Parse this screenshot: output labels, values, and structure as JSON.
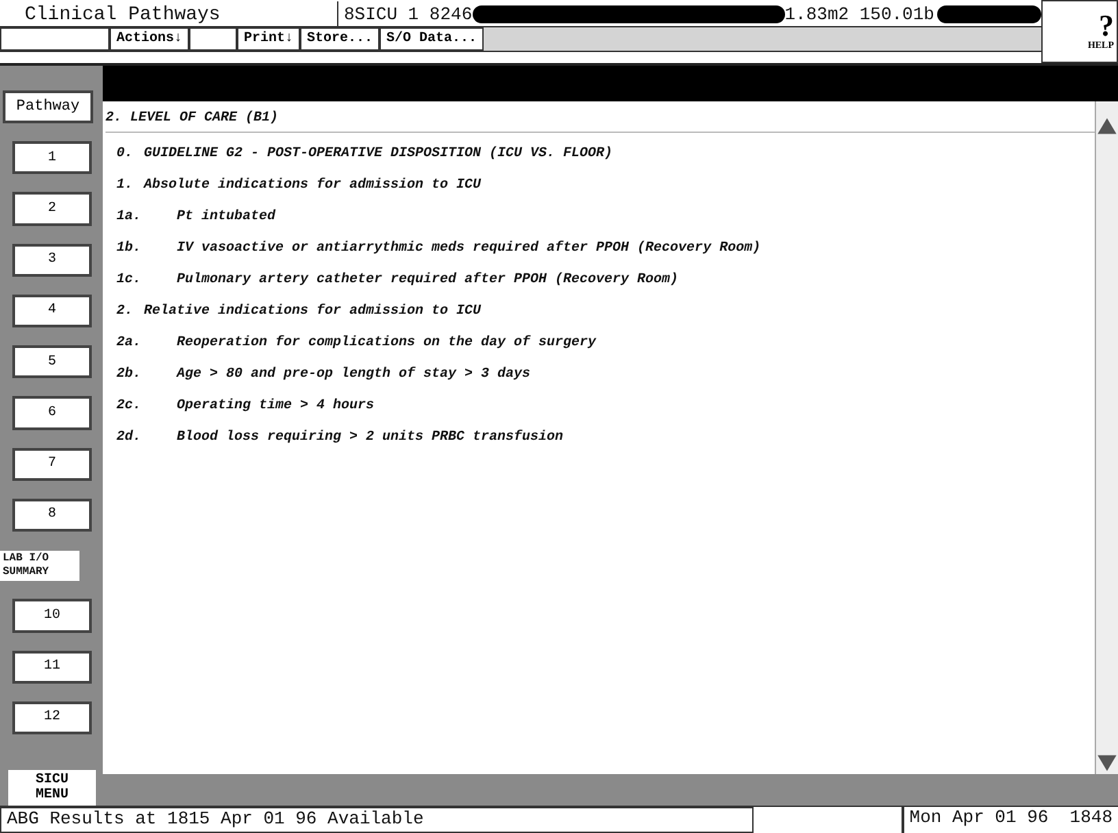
{
  "window": {
    "title": "Clinical Pathways"
  },
  "patient": {
    "unit": "8SICU 1 8246",
    "measures": "1.83m2 150.01b"
  },
  "help_button": {
    "icon": "?",
    "label": "HELP"
  },
  "toolbar": [
    {
      "kind": "blank"
    },
    {
      "label": "Actions↓"
    },
    {
      "kind": "blank"
    },
    {
      "label": "Print↓"
    },
    {
      "label": "Store..."
    },
    {
      "label": "S/O Data..."
    }
  ],
  "sidebar": {
    "header": "Pathway",
    "items": [
      {
        "label": "1"
      },
      {
        "label": "2"
      },
      {
        "label": "3"
      },
      {
        "label": "4"
      },
      {
        "label": "5"
      },
      {
        "label": "6"
      },
      {
        "label": "7"
      },
      {
        "label": "8"
      },
      {
        "overlay": "LAB I/O SUMMARY"
      },
      {
        "label": "10"
      },
      {
        "label": "11"
      },
      {
        "label": "12"
      }
    ],
    "menu": "SICU MENU"
  },
  "content": {
    "heading": "2. LEVEL OF CARE (B1)",
    "lines": [
      {
        "num": "0.",
        "text": "GUIDELINE G2 - POST-OPERATIVE DISPOSITION (ICU VS. FLOOR)",
        "kind": "head"
      },
      {
        "num": "1.",
        "text": "Absolute indications for admission to ICU",
        "kind": "head"
      },
      {
        "num": "1a.",
        "text": "Pt intubated",
        "kind": "sub"
      },
      {
        "num": "1b.",
        "text": "IV vasoactive or antiarrythmic meds required after PPOH (Recovery Room)",
        "kind": "sub"
      },
      {
        "num": "1c.",
        "text": "Pulmonary artery catheter required after PPOH (Recovery Room)",
        "kind": "sub"
      },
      {
        "num": "2.",
        "text": "Relative indications for admission to ICU",
        "kind": "head"
      },
      {
        "num": "2a.",
        "text": "Reoperation for complications on the day of surgery",
        "kind": "sub"
      },
      {
        "num": "2b.",
        "text": "Age > 80 and pre-op length of stay > 3 days",
        "kind": "sub"
      },
      {
        "num": "2c.",
        "text": "Operating time > 4 hours",
        "kind": "sub"
      },
      {
        "num": "2d.",
        "text": "Blood loss requiring > 2 units PRBC transfusion",
        "kind": "sub"
      }
    ]
  },
  "status_bar": {
    "message": "ABG Results at 1815 Apr 01 96 Available",
    "datetime": "Mon Apr 01 96  1848"
  }
}
